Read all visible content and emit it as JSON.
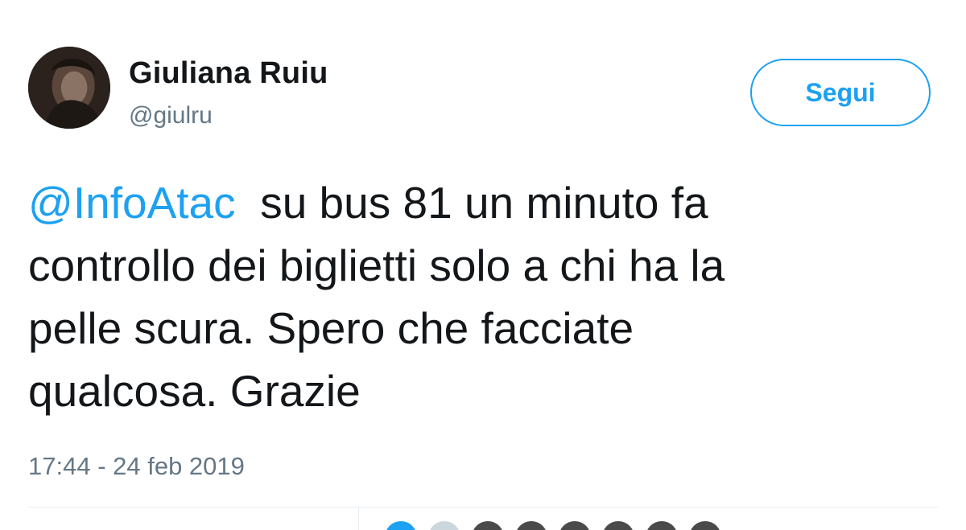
{
  "user": {
    "display_name": "Giuliana Ruiu",
    "handle": "@giulru"
  },
  "follow_button": {
    "label": "Segui"
  },
  "tweet": {
    "mention": "@InfoAtac",
    "line1_rest": "su bus 81 un minuto fa",
    "line2": "controllo dei biglietti solo a chi ha la",
    "line3": "pelle scura. Spero che facciate",
    "line4": "qualcosa. Grazie"
  },
  "timestamp": "17:44 - 24 feb 2019",
  "icons": {
    "avatar": "user-avatar-photo"
  },
  "colors": {
    "accent": "#1da1f2",
    "text": "#14171a",
    "secondary": "#657786",
    "divider": "#e6ecf0"
  }
}
